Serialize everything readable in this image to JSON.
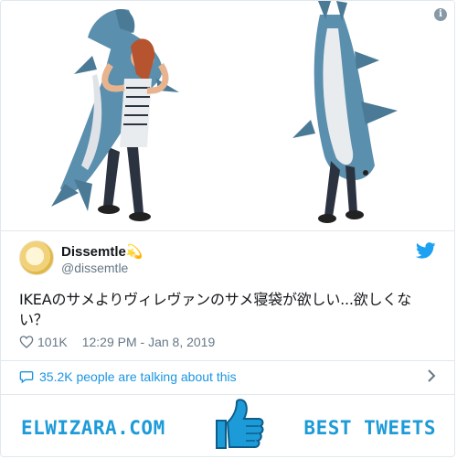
{
  "tweet": {
    "author_name": "Dissemtle",
    "author_badge": "💫",
    "author_handle": "@dissemtle",
    "text": "IKEAのサメよりヴィレヴァンのサメ寝袋が欲しい...欲しくない？",
    "likes": "101K",
    "timestamp": "12:29 PM - Jan 8, 2019",
    "talking_text": "35.2K people are talking about this"
  },
  "icons": {
    "info": "info-icon",
    "twitter": "twitter-bird-icon",
    "heart": "heart-icon",
    "bubble": "speech-bubble-icon",
    "chevron": "chevron-right-icon",
    "thumbs_up": "thumbs-up-icon"
  },
  "footer": {
    "left_brand": "ELWIZARA.COM",
    "right_brand": "BEST TWEETS"
  },
  "colors": {
    "accent": "#1b95e0",
    "brand": "#1d9bd8",
    "muted": "#657786",
    "shark": "#5b8fae"
  }
}
